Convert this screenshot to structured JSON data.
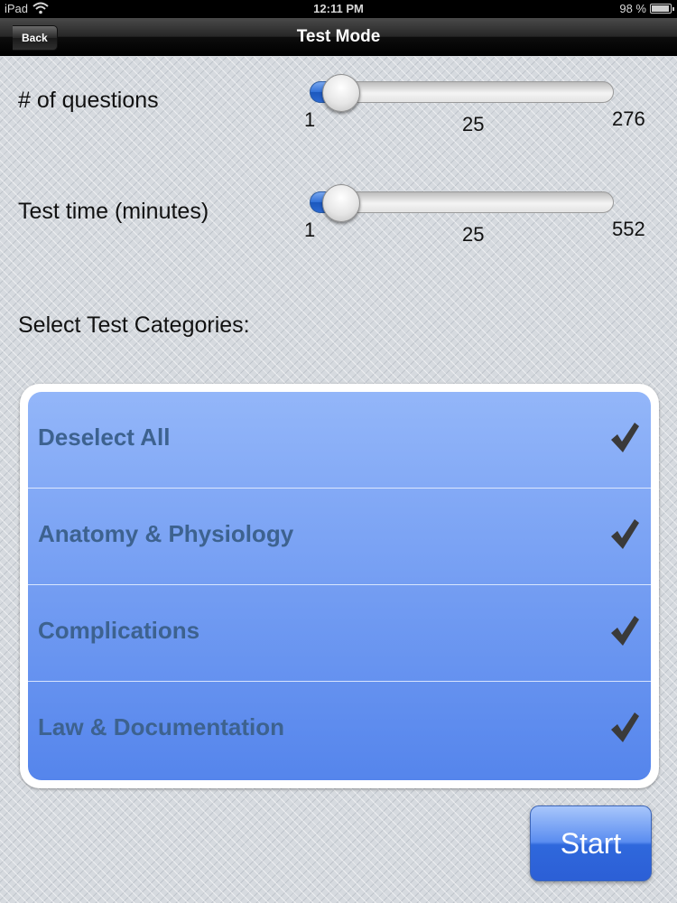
{
  "status_bar": {
    "carrier": "iPad",
    "time": "12:11 PM",
    "battery": "98 %",
    "icons": [
      "wifi-icon",
      "battery-icon"
    ]
  },
  "nav": {
    "back_label": "Back",
    "title": "Test Mode"
  },
  "questions": {
    "label": "# of questions",
    "min": "1",
    "mid": "25",
    "max": "276",
    "value": 1
  },
  "time": {
    "label": "Test time (minutes)",
    "min": "1",
    "mid": "25",
    "max": "552",
    "value": 1
  },
  "categories": {
    "heading": "Select Test Categories:",
    "items": [
      {
        "label": "Deselect All",
        "checked": true
      },
      {
        "label": "Anatomy & Physiology",
        "checked": true
      },
      {
        "label": "Complications",
        "checked": true
      },
      {
        "label": "Law & Documentation",
        "checked": true
      }
    ]
  },
  "start_label": "Start",
  "colors": {
    "slider_fill": "#2f6fd6",
    "list_top": "#93b6f9",
    "list_bottom": "#5585ec",
    "list_text": "#3d628f",
    "start_button": "#2f68dc"
  }
}
